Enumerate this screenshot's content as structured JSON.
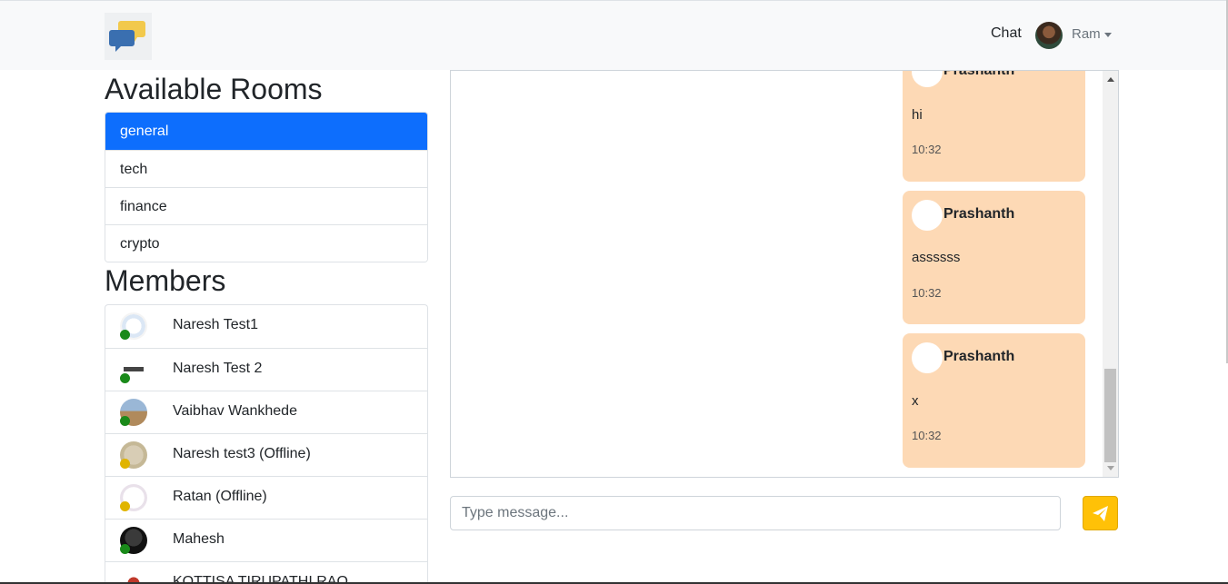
{
  "navbar": {
    "chat_link": "Chat",
    "user_name": "Ram"
  },
  "rooms": {
    "heading": "Available Rooms",
    "items": [
      {
        "label": "general",
        "active": true
      },
      {
        "label": "tech",
        "active": false
      },
      {
        "label": "finance",
        "active": false
      },
      {
        "label": "crypto",
        "active": false
      }
    ]
  },
  "members": {
    "heading": "Members",
    "items": [
      {
        "name": "Naresh Test1",
        "status": "online"
      },
      {
        "name": "Naresh Test 2",
        "status": "online"
      },
      {
        "name": "Vaibhav Wankhede",
        "status": "online"
      },
      {
        "name": "Naresh test3 (Offline)",
        "status": "offline"
      },
      {
        "name": "Ratan (Offline)",
        "status": "offline"
      },
      {
        "name": "Mahesh",
        "status": "online"
      },
      {
        "name": "KOTTISA TIRUPATHI RAO",
        "status": "online"
      }
    ]
  },
  "chat": {
    "messages": [
      {
        "sender": "Prashanth",
        "text": "hi",
        "time": "10:32"
      },
      {
        "sender": "Prashanth",
        "text": "assssss",
        "time": "10:32"
      },
      {
        "sender": "Prashanth",
        "text": "x",
        "time": "10:32"
      }
    ],
    "input_placeholder": "Type message..."
  },
  "colors": {
    "active_room": "#0d6efd",
    "message_bubble": "#fdd9b5",
    "online": "#1a8a1a",
    "offline": "#e0b400",
    "send_button": "#ffc107"
  },
  "icons": {
    "logo": "chat-bubbles-icon",
    "send": "paper-plane-icon"
  }
}
